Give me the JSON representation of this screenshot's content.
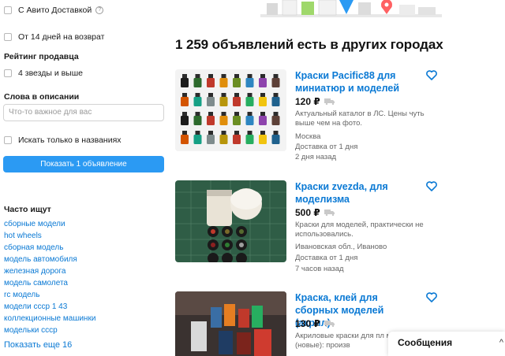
{
  "filters": {
    "avito_delivery": "С Авито Доставкой",
    "return_14": "От 14 дней на возврат",
    "seller_rating_title": "Рейтинг продавца",
    "four_stars": "4 звезды и выше",
    "words_title": "Слова в описании",
    "words_placeholder": "Что-то важное для вас",
    "only_titles": "Искать только в названиях",
    "show_button": "Показать 1 объявление"
  },
  "frequent": {
    "title": "Часто ищут",
    "items": [
      "сборные модели",
      "hot wheels",
      "сборная модель",
      "модель автомобиля",
      "железная дорога",
      "модель самолета",
      "rc модель",
      "модели ссср 1 43",
      "коллекционные машинки",
      "модельки ссср"
    ],
    "show_more": "Показать еще 16"
  },
  "results": {
    "title": "1 259 объявлений есть в других городах"
  },
  "listings": [
    {
      "title": "Краски Pacific88 для миниатюр и моделей",
      "price": "120 ₽",
      "desc": "Актуальный каталог в ЛС. Цены чуть выше чем на фото.",
      "location": "Москва",
      "delivery": "Доставка от 1 дня",
      "time": "2 дня назад"
    },
    {
      "title": "Краски zvezda, для моделизма",
      "price": "500 ₽",
      "desc": "Краски для моделей, практически не использовались.",
      "location": "Ивановская обл., Иваново",
      "delivery": "Доставка от 1 дня",
      "time": "7 часов назад"
    },
    {
      "title": "Краска, клей для сборных моделей (акрил)",
      "price": "130 ₽",
      "desc": "Акриловые краски для пл моделей (новые): произв"
    }
  ],
  "messages": {
    "label": "Сообщения",
    "chevron": "^"
  },
  "colors": {
    "link": "#0a79d4",
    "button": "#2b9af3"
  }
}
